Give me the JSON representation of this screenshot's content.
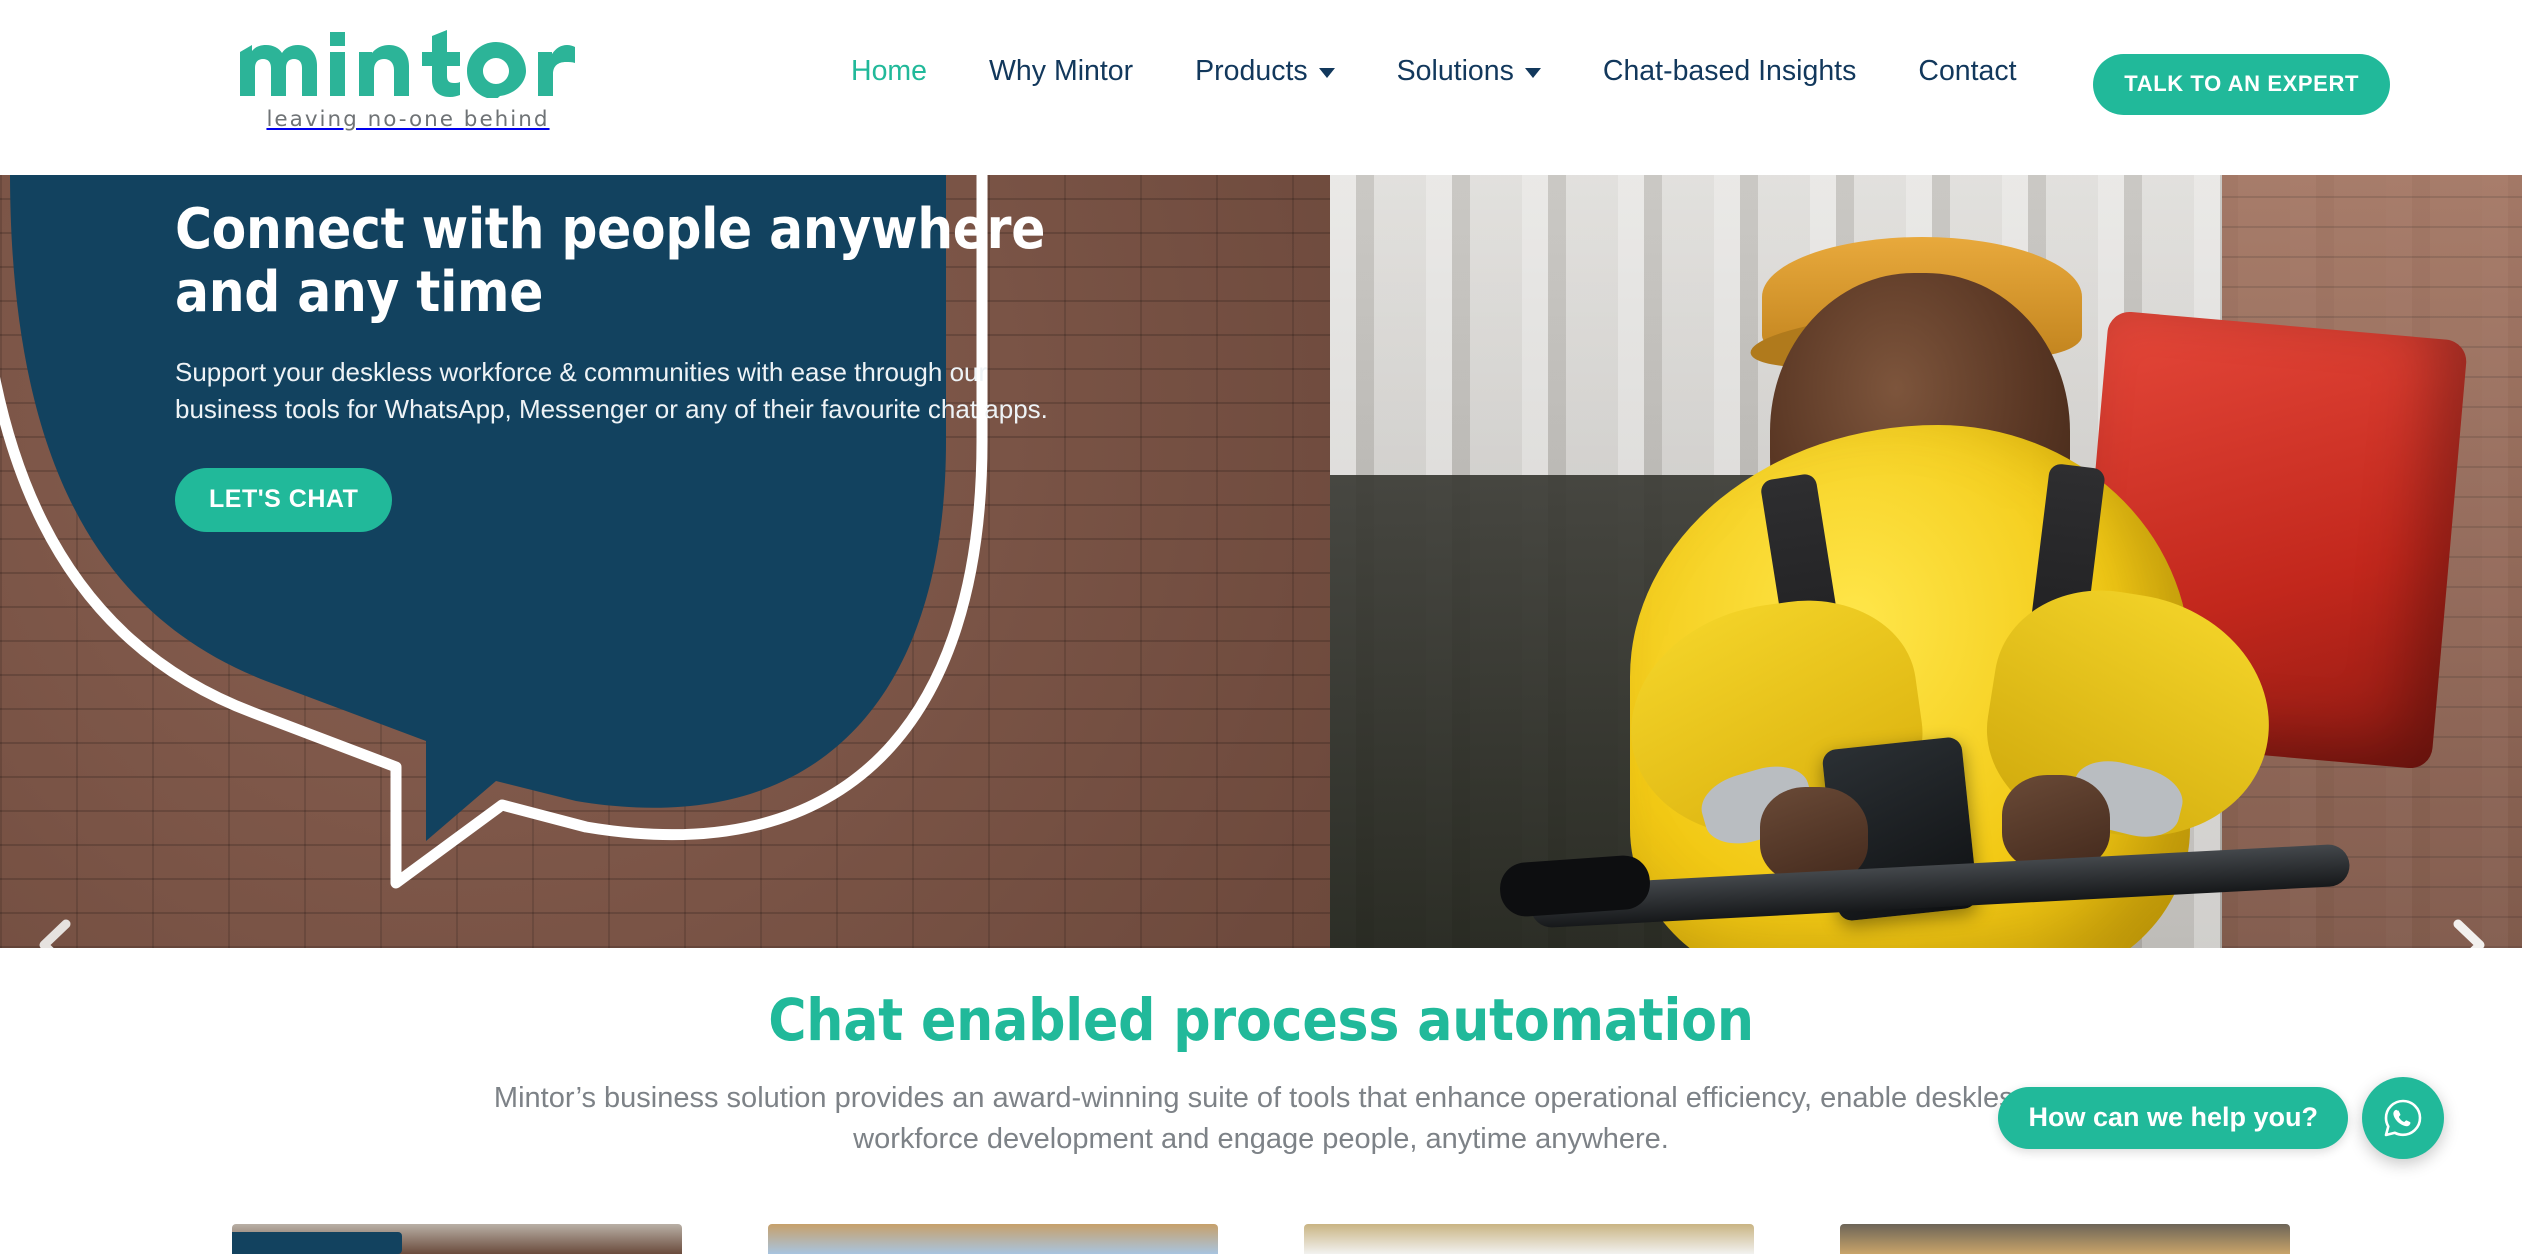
{
  "brand": {
    "name": "mintor",
    "tagline": "leaving no-one behind",
    "accent_teal": "#21b99a",
    "navy": "#12425f"
  },
  "header": {
    "nav": [
      {
        "label": "Home",
        "active": true,
        "has_dropdown": false
      },
      {
        "label": "Why Mintor",
        "active": false,
        "has_dropdown": false
      },
      {
        "label": "Products",
        "active": false,
        "has_dropdown": true
      },
      {
        "label": "Solutions",
        "active": false,
        "has_dropdown": true
      },
      {
        "label": "Chat-based Insights",
        "active": false,
        "has_dropdown": false
      },
      {
        "label": "Contact",
        "active": false,
        "has_dropdown": false
      }
    ],
    "cta_label": "TALK TO AN EXPERT"
  },
  "hero": {
    "title": "Connect with people anywhere\nand any time",
    "subtitle": "Support your deskless workforce & communities with ease through our\nbusiness tools for WhatsApp, Messenger or any of their favourite chat apps.",
    "button_label": "LET'S CHAT",
    "prev_icon": "chevron-left-icon",
    "next_icon": "chevron-right-icon"
  },
  "section": {
    "title": "Chat enabled process automation",
    "body": "Mintor’s business solution provides an award-winning suite of tools that enhance operational efficiency, enable deskless workforce development and engage people, anytime anywhere."
  },
  "cards": [
    {
      "name": "card-1"
    },
    {
      "name": "card-2"
    },
    {
      "name": "card-3"
    },
    {
      "name": "card-4"
    }
  ],
  "whatsapp_widget": {
    "label": "How can we help you?",
    "icon": "whatsapp-icon"
  }
}
